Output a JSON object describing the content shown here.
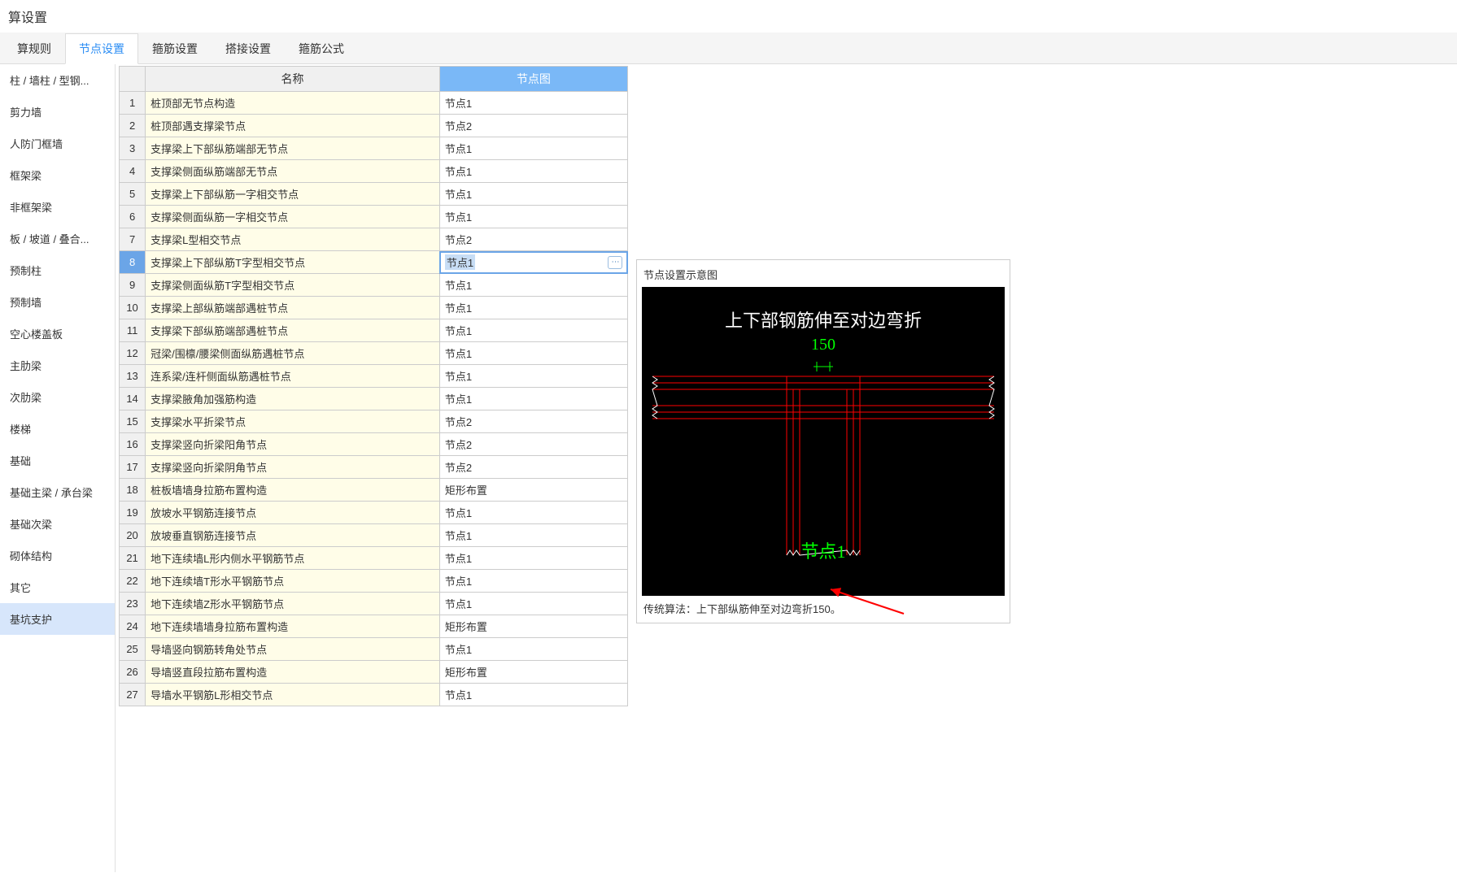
{
  "page_title": "算设置",
  "tabs": [
    "算规则",
    "节点设置",
    "箍筋设置",
    "搭接设置",
    "箍筋公式"
  ],
  "active_tab": 1,
  "sidebar": {
    "items": [
      "柱 / 墙柱 / 型钢...",
      "剪力墙",
      "人防门框墙",
      "框架梁",
      "非框架梁",
      "板 / 坡道 / 叠合...",
      "预制柱",
      "预制墙",
      "空心楼盖板",
      "主肋梁",
      "次肋梁",
      "楼梯",
      "基础",
      "基础主梁 / 承台梁",
      "基础次梁",
      "砌体结构",
      "其它",
      "基坑支护"
    ],
    "selected": 17
  },
  "table": {
    "headers": {
      "name": "名称",
      "node": "节点图"
    },
    "rows": [
      {
        "name": "桩顶部无节点构造",
        "node": "节点1"
      },
      {
        "name": "桩顶部遇支撑梁节点",
        "node": "节点2"
      },
      {
        "name": "支撑梁上下部纵筋端部无节点",
        "node": "节点1"
      },
      {
        "name": "支撑梁侧面纵筋端部无节点",
        "node": "节点1"
      },
      {
        "name": "支撑梁上下部纵筋一字相交节点",
        "node": "节点1"
      },
      {
        "name": "支撑梁侧面纵筋一字相交节点",
        "node": "节点1"
      },
      {
        "name": "支撑梁L型相交节点",
        "node": "节点2"
      },
      {
        "name": "支撑梁上下部纵筋T字型相交节点",
        "node": "节点1"
      },
      {
        "name": "支撑梁侧面纵筋T字型相交节点",
        "node": "节点1"
      },
      {
        "name": "支撑梁上部纵筋端部遇桩节点",
        "node": "节点1"
      },
      {
        "name": "支撑梁下部纵筋端部遇桩节点",
        "node": "节点1"
      },
      {
        "name": "冠梁/围檩/腰梁侧面纵筋遇桩节点",
        "node": "节点1"
      },
      {
        "name": "连系梁/连杆侧面纵筋遇桩节点",
        "node": "节点1"
      },
      {
        "name": "支撑梁腋角加强筋构造",
        "node": "节点1"
      },
      {
        "name": "支撑梁水平折梁节点",
        "node": "节点2"
      },
      {
        "name": "支撑梁竖向折梁阳角节点",
        "node": "节点2"
      },
      {
        "name": "支撑梁竖向折梁阴角节点",
        "node": "节点2"
      },
      {
        "name": "桩板墙墙身拉筋布置构造",
        "node": "矩形布置"
      },
      {
        "name": "放坡水平钢筋连接节点",
        "node": "节点1"
      },
      {
        "name": "放坡垂直钢筋连接节点",
        "node": "节点1"
      },
      {
        "name": "地下连续墙L形内侧水平钢筋节点",
        "node": "节点1"
      },
      {
        "name": "地下连续墙T形水平钢筋节点",
        "node": "节点1"
      },
      {
        "name": "地下连续墙Z形水平钢筋节点",
        "node": "节点1"
      },
      {
        "name": "地下连续墙墙身拉筋布置构造",
        "node": "矩形布置"
      },
      {
        "name": "导墙竖向钢筋转角处节点",
        "node": "节点1"
      },
      {
        "name": "导墙竖直段拉筋布置构造",
        "node": "矩形布置"
      },
      {
        "name": "导墙水平钢筋L形相交节点",
        "node": "节点1"
      }
    ],
    "selected_row": 7
  },
  "preview": {
    "title": "节点设置示意图",
    "diagram_title": "上下部钢筋伸至对边弯折",
    "diagram_dim": "150",
    "diagram_label": "节点1",
    "description": "传统算法：上下部纵筋伸至对边弯折150。"
  }
}
